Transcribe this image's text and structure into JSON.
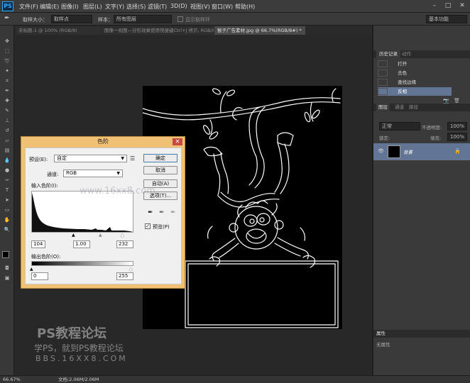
{
  "menubar": {
    "logo": "PS",
    "items": [
      "文件(F)",
      "编辑(E)",
      "图像(I)",
      "图层(L)",
      "文字(Y)",
      "选择(S)",
      "滤镜(T)",
      "3D(D)",
      "视图(V)",
      "窗口(W)",
      "帮助(H)"
    ]
  },
  "optionsbar": {
    "sample_size_label": "取样大小：",
    "sample_size_value": "取样点",
    "sample_label": "样本：",
    "sample_value": "所有图层",
    "show_ring_label": "显示取样环",
    "workspace": "基本功能"
  },
  "tabs": [
    {
      "label": "未标题-1 @ 100% (RGB/8)",
      "active": false
    },
    {
      "label": "图像一视图—分形效果使用快捷键Ctrl+J 拷贝, RGB/8) *",
      "active": false
    },
    {
      "label": "猴子广告素材.jpg @ 66.7%(RGB/8#) *",
      "active": true
    }
  ],
  "history_panel": {
    "tabs": [
      "历史记录",
      "动作"
    ],
    "items": [
      "打开",
      "去色",
      "查找边缘",
      "反相"
    ]
  },
  "layers_panel": {
    "tabs": [
      "图层",
      "通道",
      "路径"
    ],
    "kind": "正常",
    "opacity_label": "不透明度:",
    "opacity": "100%",
    "lock_label": "锁定:",
    "fill_label": "填充:",
    "fill": "100%",
    "layer_name": "背景"
  },
  "properties_panel": {
    "title": "属性",
    "content": "无属性"
  },
  "status": {
    "zoom": "66.67%",
    "doc": "文档:2.06M/2.06M"
  },
  "levels_dialog": {
    "title": "色阶",
    "preset_label": "预设(E):",
    "preset_value": "自定",
    "channel_label": "通道:",
    "channel_value": "RGB",
    "input_label": "输入色阶(I):",
    "output_label": "输出色阶(O):",
    "input_black": "104",
    "input_gamma": "1.00",
    "input_white": "232",
    "output_black": "0",
    "output_white": "255",
    "ok": "确定",
    "cancel": "取消",
    "auto": "自动(A)",
    "options": "选项(T)...",
    "preview": "预览(P)",
    "preview_checked": true
  },
  "watermark": {
    "line1": "PS教程论坛",
    "line2": "学PS，就到PS教程论坛",
    "line3": "BBS.16XX8.COM",
    "center": "www.16xx8.com"
  }
}
